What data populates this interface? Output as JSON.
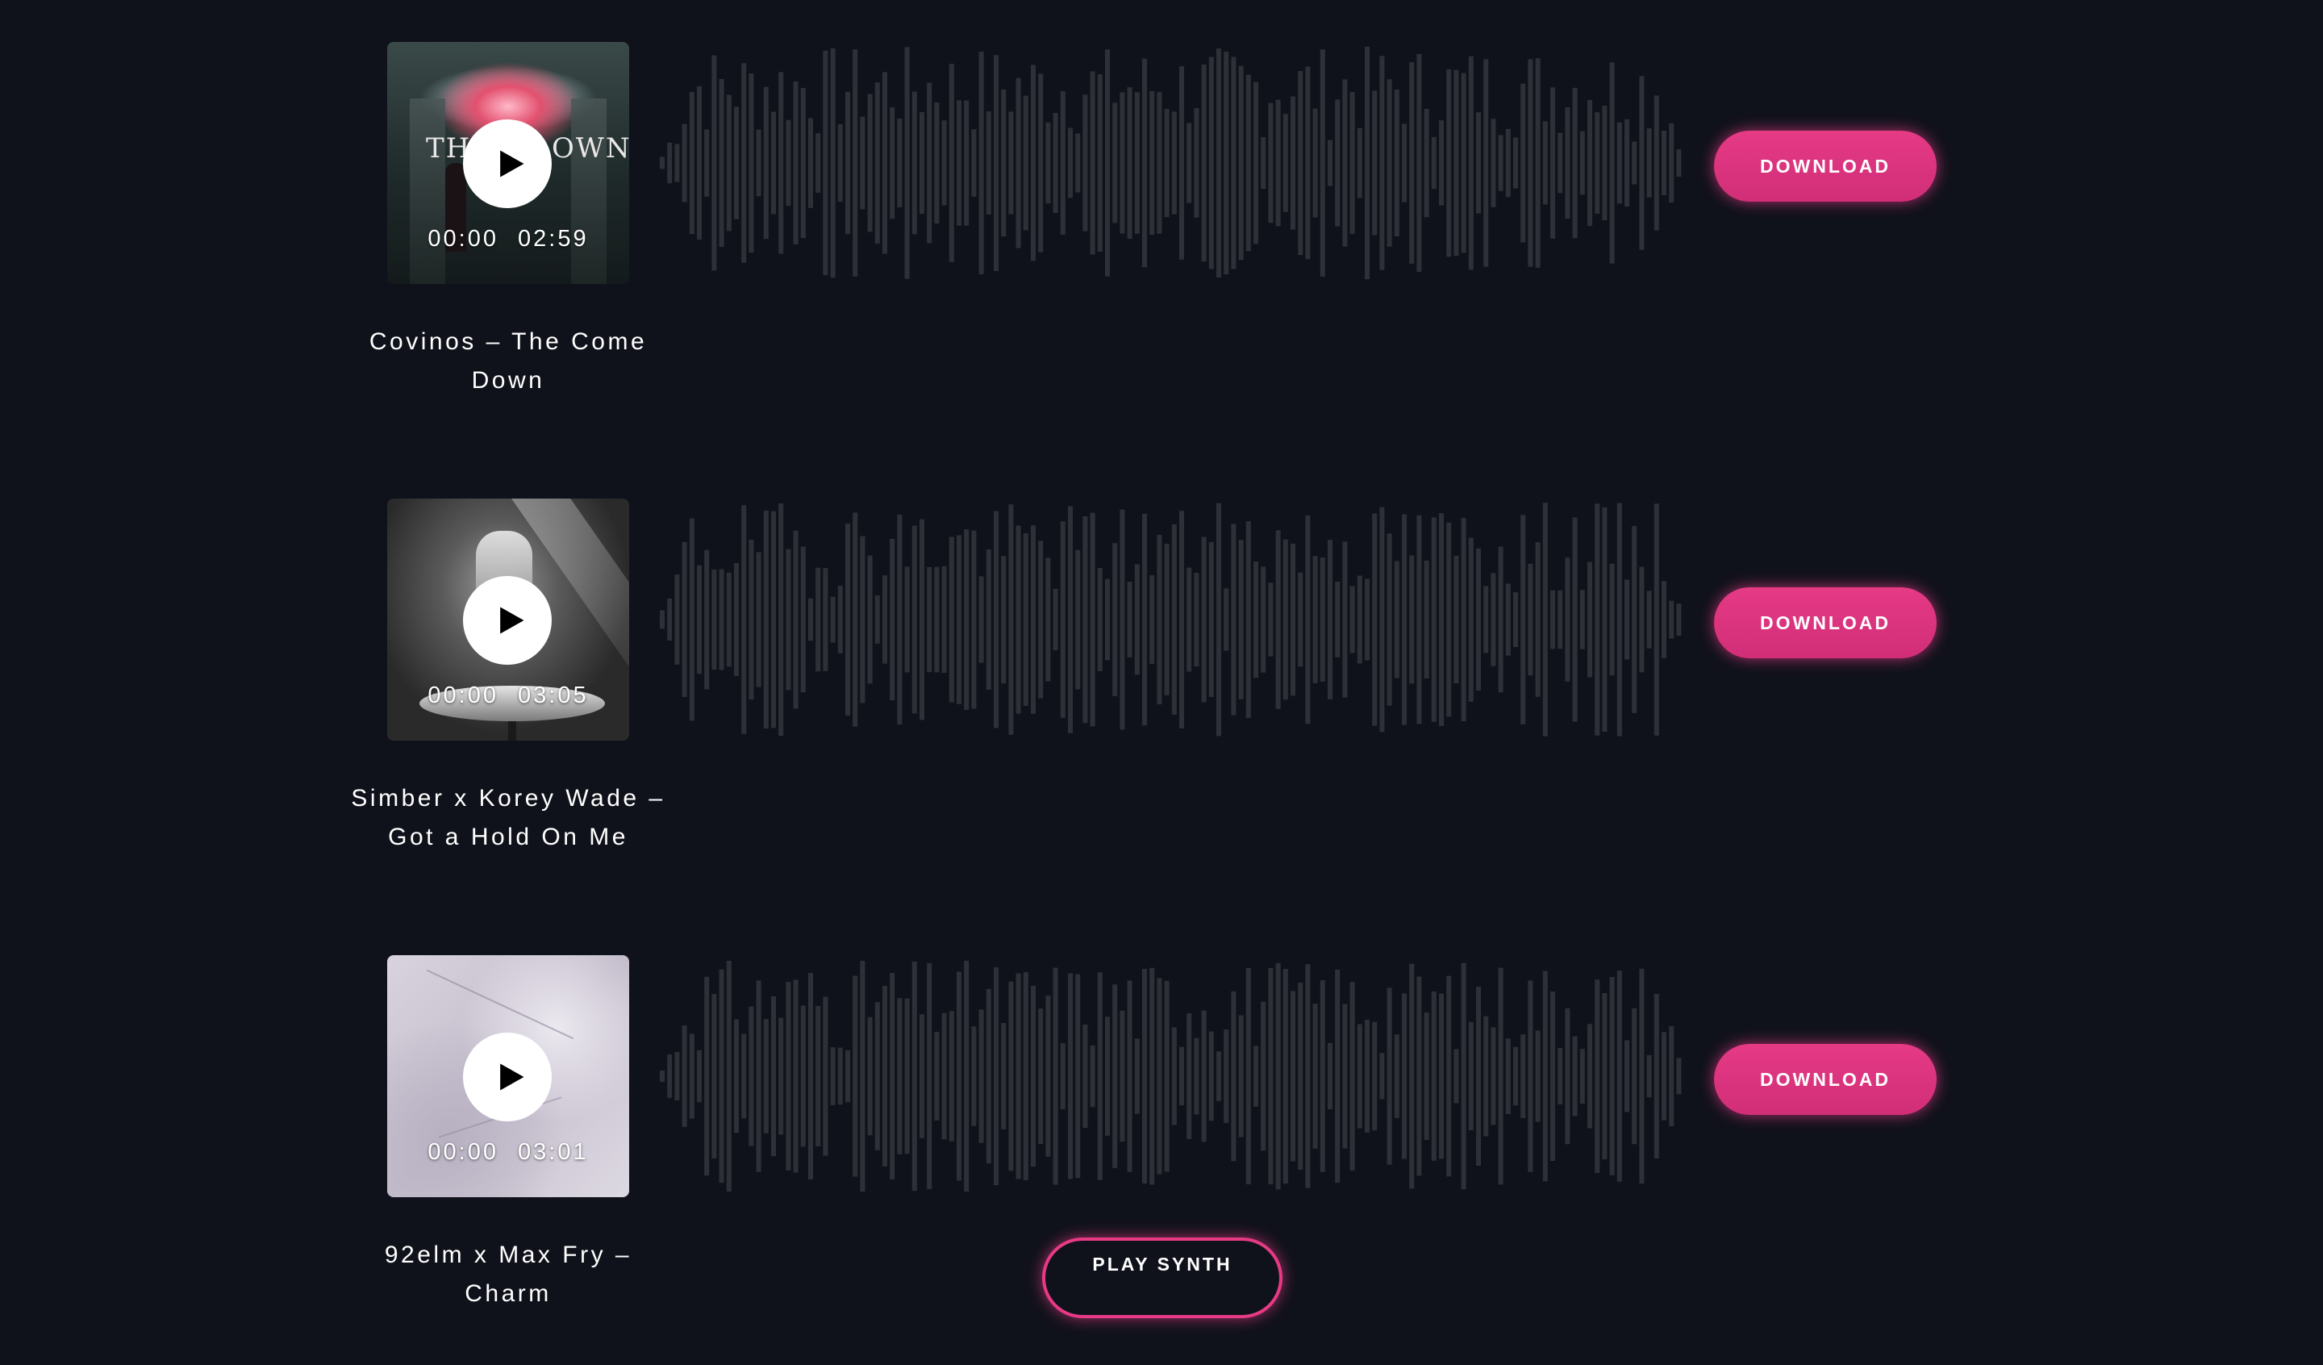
{
  "colors": {
    "background": "#10121b",
    "accent": "#e63a85",
    "waveform": "#2e3038",
    "text": "#ffffff"
  },
  "tracks": [
    {
      "title": "Covinos – The Come Down",
      "current_time": "00:00",
      "duration": "02:59",
      "play_icon": "play-icon",
      "download_label": "DOWNLOAD",
      "cover_text_left": "THE",
      "cover_text_right": "OWN"
    },
    {
      "title": "Simber x Korey Wade – Got a Hold On Me",
      "current_time": "00:00",
      "duration": "03:05",
      "play_icon": "play-icon",
      "download_label": "DOWNLOAD"
    },
    {
      "title": "92elm x Max Fry – Charm",
      "current_time": "00:00",
      "duration": "03:01",
      "play_icon": "play-icon",
      "download_label": "DOWNLOAD"
    }
  ],
  "synth_button": {
    "label": "PLAY SYNTH"
  }
}
